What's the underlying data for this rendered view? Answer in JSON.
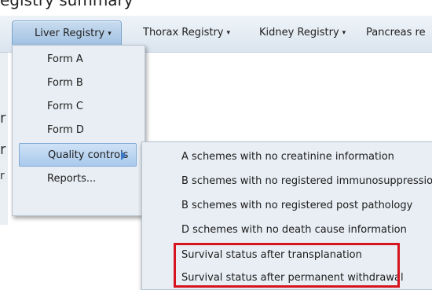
{
  "page": {
    "title_fragment": "egistry summary",
    "left_fragments": [
      "r",
      "r",
      "r"
    ]
  },
  "navbar": {
    "items": [
      {
        "label": "Liver Registry",
        "active": true
      },
      {
        "label": "Thorax Registry",
        "active": false
      },
      {
        "label": "Kidney Registry",
        "active": false
      },
      {
        "label": "Pancreas re",
        "active": false
      }
    ],
    "caret": "▾"
  },
  "dropdown": {
    "items": [
      {
        "label": "Form A"
      },
      {
        "label": "Form B"
      },
      {
        "label": "Form C"
      },
      {
        "label": "Form D"
      },
      {
        "label": "Quality controls",
        "active": true,
        "has_submenu": true
      },
      {
        "label": "Reports..."
      }
    ]
  },
  "submenu": {
    "items": [
      {
        "label": "A schemes with no creatinine information"
      },
      {
        "label": "B schemes with no registered immunosuppression"
      },
      {
        "label": "B schemes with no registered post pathology"
      },
      {
        "label": "D schemes with no death cause information"
      },
      {
        "label": "Survival status after transplanation"
      },
      {
        "label": "Survival status after permanent withdrawal"
      }
    ]
  },
  "colors": {
    "highlight": "#d6141e",
    "accent": "#3d78c4"
  }
}
